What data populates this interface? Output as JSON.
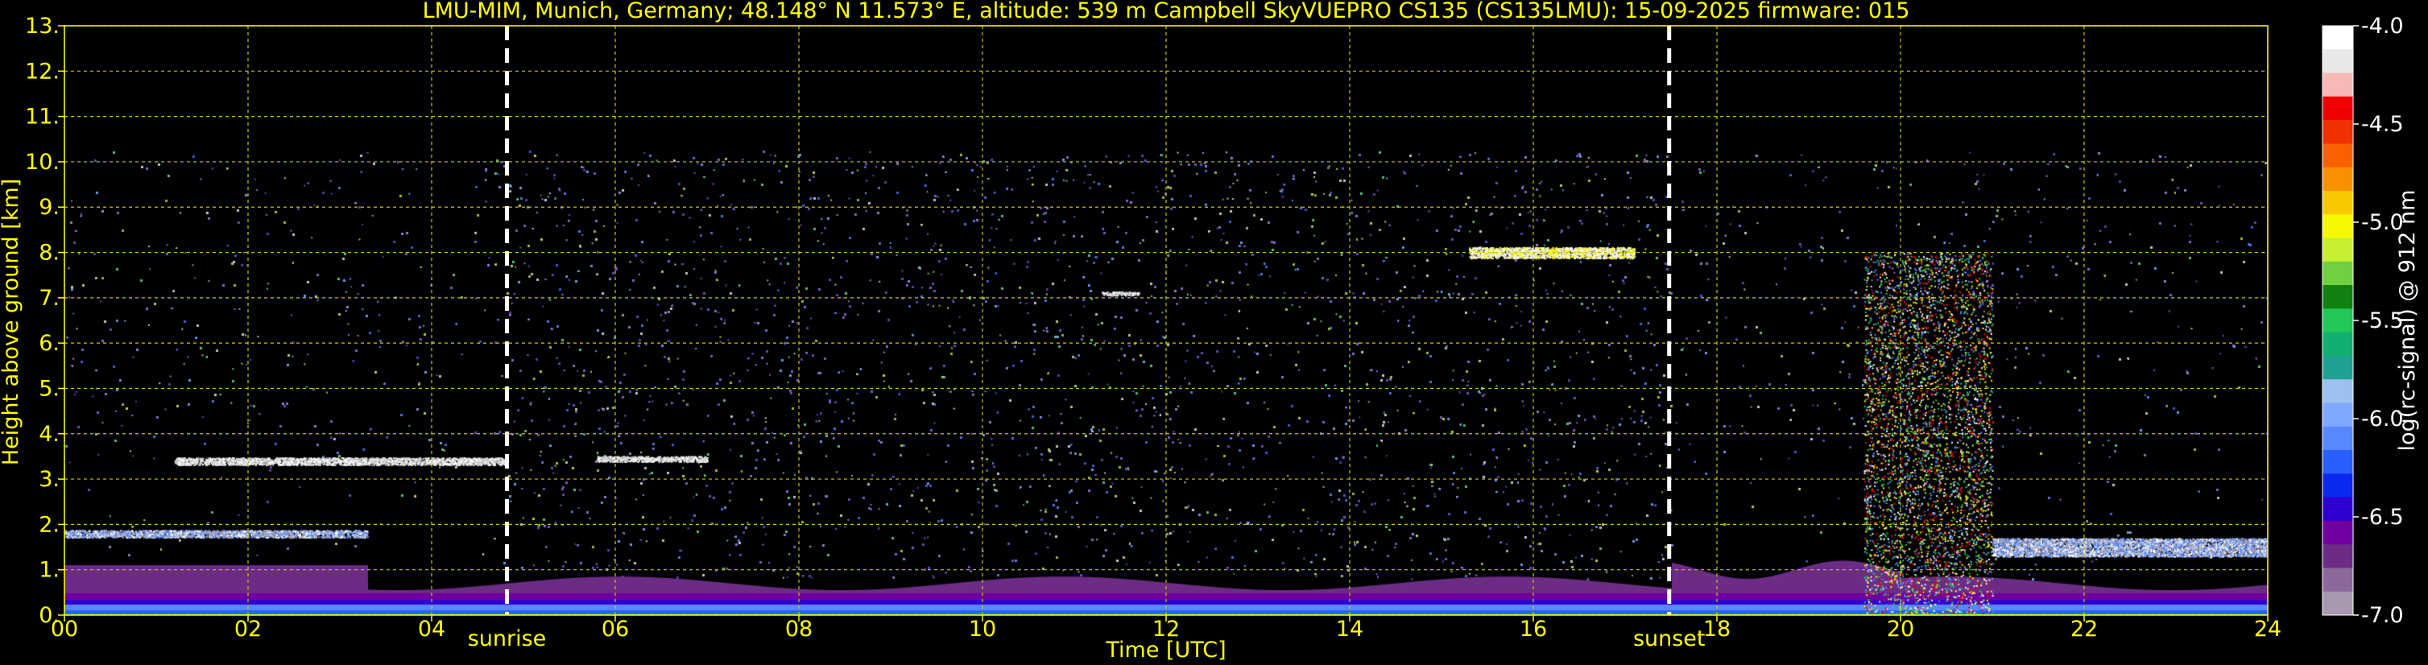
{
  "title": "LMU-MIM, Munich, Germany; 48.148° N 11.573° E, altitude: 539 m    Campbell SkyVUEPRO CS135 (CS135LMU): 15-09-2025    firmware: 015",
  "chart_data": {
    "type": "heatmap",
    "title": "LMU-MIM, Munich, Germany; 48.148° N 11.573° E, altitude: 539 m    Campbell SkyVUEPRO CS135 (CS135LMU): 15-09-2025    firmware: 015",
    "xlabel": "Time [UTC]",
    "ylabel": "Height above ground [km]",
    "xlim": [
      0,
      24
    ],
    "ylim": [
      0,
      13
    ],
    "x_ticks": [
      "00",
      "02",
      "04",
      "06",
      "08",
      "10",
      "12",
      "14",
      "16",
      "18",
      "20",
      "22",
      "24"
    ],
    "y_ticks": [
      "0.",
      "1.",
      "2.",
      "3.",
      "4.",
      "5.",
      "6.",
      "7.",
      "8.",
      "9.",
      "10.",
      "11.",
      "12.",
      "13."
    ],
    "grid": true,
    "annotations": [
      {
        "label": "sunrise",
        "time": 4.82
      },
      {
        "label": "sunset",
        "time": 17.48
      }
    ],
    "colorbar": {
      "label": "log(rc-signal) @ 912 nm",
      "range": [
        -7.0,
        -4.0
      ],
      "ticks": [
        "-4.0",
        "-4.5",
        "-5.0",
        "-5.5",
        "-6.0",
        "-6.5",
        "-7.0"
      ],
      "colors": [
        "#a898b0",
        "#8a6a9c",
        "#6c2c86",
        "#7000a0",
        "#3000d0",
        "#0a28f0",
        "#2860ff",
        "#5888ff",
        "#80a8ff",
        "#9cc0f0",
        "#20a090",
        "#10b070",
        "#20c858",
        "#108010",
        "#70d040",
        "#c8f030",
        "#f8f800",
        "#f8c800",
        "#f89000",
        "#f86000",
        "#f03000",
        "#f00000",
        "#f8b8b8",
        "#e8e8e8",
        "#ffffff"
      ]
    },
    "features": [
      {
        "name": "boundary layer aerosol",
        "time": [
          0,
          24
        ],
        "height_km": [
          0.1,
          0.9
        ]
      },
      {
        "name": "low cloud",
        "time": [
          0,
          3.3
        ],
        "height_km": [
          1.6,
          2.0
        ]
      },
      {
        "name": "cloud",
        "time": [
          1.2,
          4.8
        ],
        "height_km": [
          3.2,
          3.6
        ]
      },
      {
        "name": "cloud",
        "time": [
          5.8,
          7.0
        ],
        "height_km": [
          3.3,
          3.6
        ]
      },
      {
        "name": "cloud",
        "time": [
          11.3,
          11.7
        ],
        "height_km": [
          7.0,
          7.2
        ]
      },
      {
        "name": "cirrus",
        "time": [
          15.3,
          17.1
        ],
        "height_km": [
          7.7,
          8.3
        ]
      },
      {
        "name": "precipitating cloud",
        "time": [
          19.6,
          21.0
        ],
        "height_km": [
          0,
          8.0
        ]
      },
      {
        "name": "low cloud",
        "time": [
          21.0,
          24
        ],
        "height_km": [
          1.0,
          2.0
        ]
      }
    ]
  }
}
